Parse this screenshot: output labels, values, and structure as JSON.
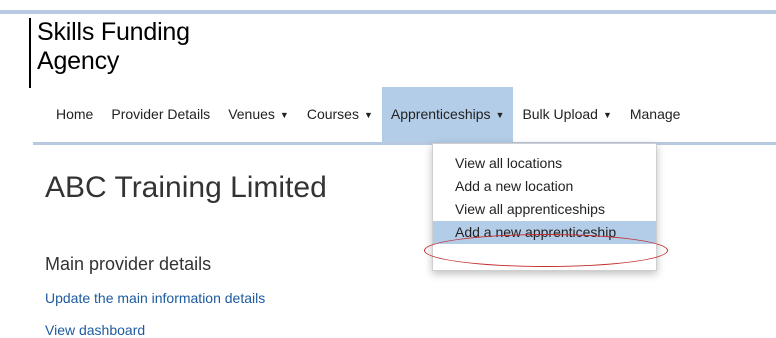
{
  "brand": {
    "line1": "Skills Funding",
    "line2": "Agency"
  },
  "nav": [
    {
      "label": "Home",
      "has_dropdown": false,
      "active": false
    },
    {
      "label": "Provider Details",
      "has_dropdown": false,
      "active": false
    },
    {
      "label": "Venues",
      "has_dropdown": true,
      "active": false
    },
    {
      "label": "Courses",
      "has_dropdown": true,
      "active": false
    },
    {
      "label": "Apprenticeships",
      "has_dropdown": true,
      "active": true
    },
    {
      "label": "Bulk Upload",
      "has_dropdown": true,
      "active": false
    },
    {
      "label": "Manage",
      "has_dropdown": false,
      "active": false
    }
  ],
  "caret_glyph": "▼",
  "dropdown": {
    "items": [
      "View all locations",
      "Add a new location",
      "View all apprenticeships",
      "Add a new apprenticeship"
    ],
    "highlighted_index": 3,
    "annotation_color": "#c42a2a"
  },
  "page": {
    "title": "ABC Training Limited",
    "section_heading": "Main provider details",
    "links": [
      "Update the main information details",
      "View dashboard"
    ]
  },
  "colors": {
    "accent": "#b3cde8",
    "rule": "#b7c9e1",
    "link": "#1c5b9e"
  }
}
